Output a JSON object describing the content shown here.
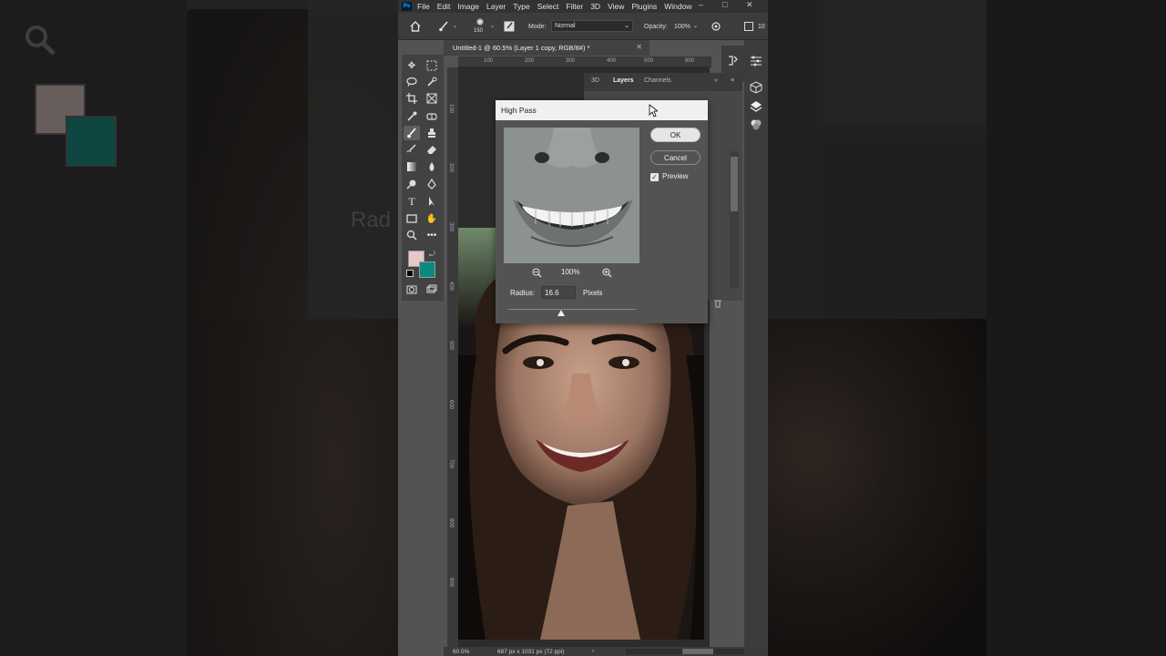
{
  "menu": {
    "logo": "Ps",
    "items": [
      "File",
      "Edit",
      "Image",
      "Layer",
      "Type",
      "Select",
      "Filter",
      "3D",
      "View",
      "Plugins",
      "Window"
    ]
  },
  "options": {
    "brush_size": "150",
    "mode_label": "Mode:",
    "mode_value": "Normal",
    "opacity_label": "Opacity:",
    "opacity_value": "100%",
    "flow_value": "10"
  },
  "document": {
    "tab_title": "Untitled-1 @ 60.5% (Layer 1 copy, RGB/8#) *",
    "ruler_top": [
      "100",
      "200",
      "300",
      "400",
      "500",
      "600"
    ],
    "ruler_left": [
      "100",
      "200",
      "300",
      "400",
      "500",
      "600",
      "700",
      "800",
      "900"
    ]
  },
  "panels": {
    "tabs": [
      "3D",
      "Layers",
      "Channels"
    ]
  },
  "dialog": {
    "title": "High Pass",
    "ok": "OK",
    "cancel": "Cancel",
    "preview_label": "Preview",
    "preview_checked": true,
    "zoom": "100%",
    "radius_label": "Radius:",
    "radius_value": "16.6",
    "radius_unit": "Pixels"
  },
  "status": {
    "zoom": "60.5%",
    "doc_info": "687 px x 1031 px (72 ppi)"
  },
  "colors": {
    "foreground": "#e8c8c8",
    "background": "#0d8a80"
  },
  "background_blur": {
    "radius_text": "Rad"
  }
}
